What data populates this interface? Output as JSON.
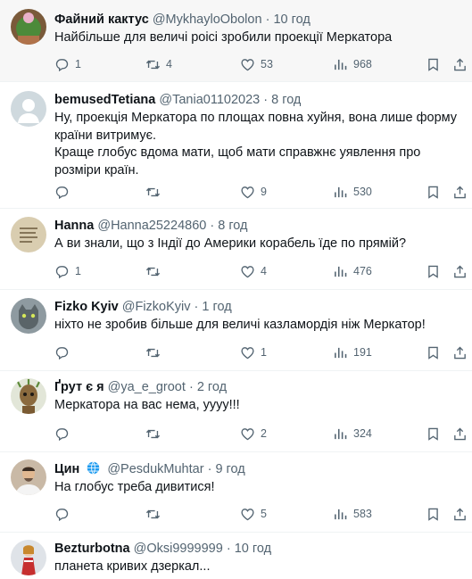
{
  "tweets": [
    {
      "name": "Файний кактус",
      "handle": "@MykhayloObolon",
      "dot": "·",
      "time": "10 год",
      "verified": false,
      "lines": [
        "Найбільше для величі роісі зробили проекції Меркатора"
      ],
      "replies": "1",
      "retweets": "4",
      "likes": "53",
      "views": "968",
      "avatar_icon": "cactus-avatar"
    },
    {
      "name": "bemusedTetiana",
      "handle": "@Tania01102023",
      "dot": "·",
      "time": "8 год",
      "verified": false,
      "lines": [
        "Ну, проекція Меркатора по площах повна хуйня, вона лише форму країни витримує.",
        "Краще глобус вдома мати, щоб мати справжнє уявлення про розміри країн."
      ],
      "replies": "",
      "retweets": "",
      "likes": "9",
      "views": "530",
      "avatar_icon": "default-avatar"
    },
    {
      "name": "Hanna",
      "handle": "@Hanna25224860",
      "dot": "·",
      "time": "8 год",
      "verified": false,
      "lines": [
        "А ви знали, що з Індії до Америки корабель їде по прямій?"
      ],
      "replies": "1",
      "retweets": "",
      "likes": "4",
      "views": "476",
      "avatar_icon": "paper-avatar"
    },
    {
      "name": "Fizko Kyiv",
      "handle": "@FizkoKyiv",
      "dot": "·",
      "time": "1 год",
      "verified": false,
      "lines": [
        "ніхто не зробив більше для величі казламордія ніж Меркатор!"
      ],
      "replies": "",
      "retweets": "",
      "likes": "1",
      "views": "191",
      "avatar_icon": "cat-avatar"
    },
    {
      "name": "Ґрут є я",
      "handle": "@ya_e_groot",
      "dot": "·",
      "time": "2 год",
      "verified": false,
      "lines": [
        "Меркатора на вас нема, уууу!!!"
      ],
      "replies": "",
      "retweets": "",
      "likes": "2",
      "views": "324",
      "avatar_icon": "groot-avatar"
    },
    {
      "name": "Цин",
      "handle": "@PesdukMuhtar",
      "dot": "·",
      "time": "9 год",
      "verified": true,
      "lines": [
        "На глобус треба дивитися!"
      ],
      "replies": "",
      "retweets": "",
      "likes": "5",
      "views": "583",
      "avatar_icon": "man-avatar"
    },
    {
      "name": "Bezturbotna",
      "handle": "@Oksi9999999",
      "dot": "·",
      "time": "10 год",
      "verified": false,
      "lines": [
        "планета кривих дзеркал..."
      ],
      "replies": "",
      "retweets": "",
      "likes": "",
      "views": "",
      "avatar_icon": "figurine-avatar"
    }
  ],
  "colors": {
    "text": "#0f1419",
    "secondary": "#536471",
    "divider": "#eff3f4",
    "highlight_bg": "#f7f7f7"
  }
}
